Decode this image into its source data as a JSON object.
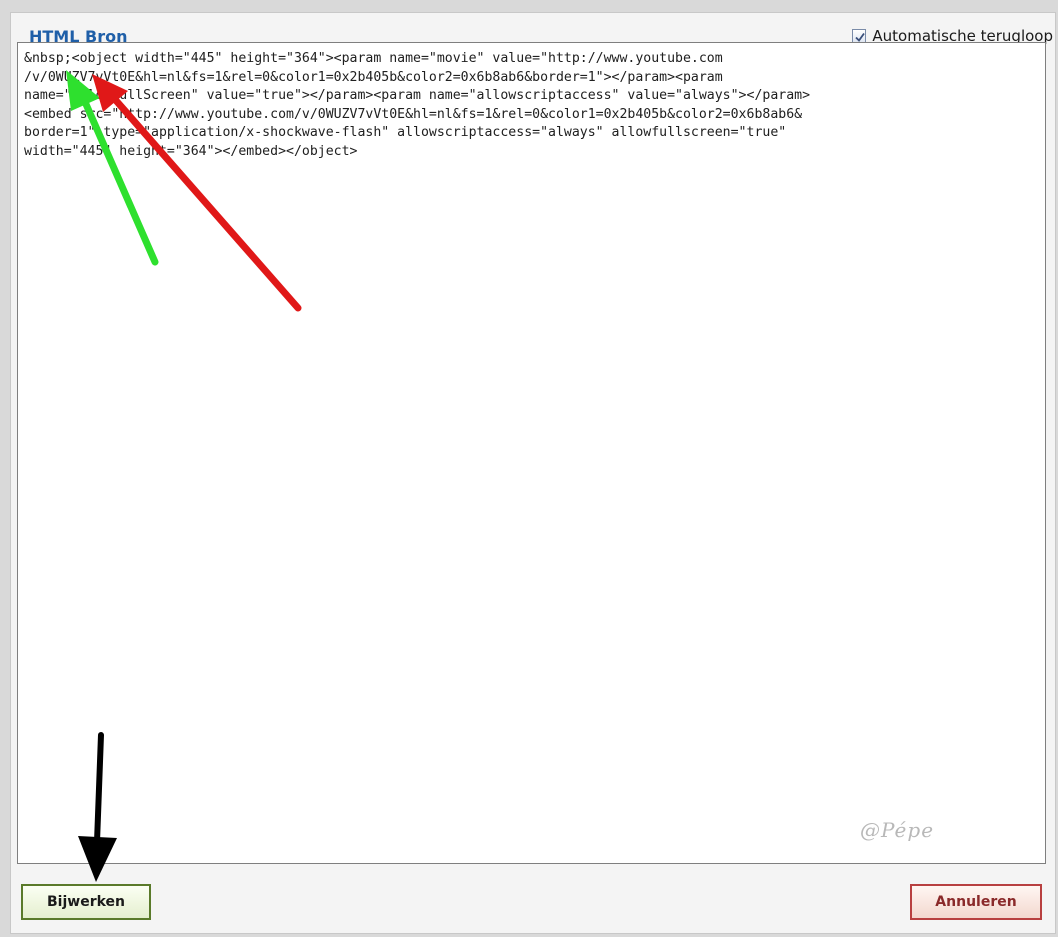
{
  "dialog": {
    "title": "HTML Bron",
    "wrap_option": {
      "label": "Automatische terugloop",
      "checked": true
    },
    "source_lines": [
      "&nbsp;<object width=\"445\" height=\"364\"><param name=\"movie\" value=\"http://www.youtube.com",
      "/v/0WUZV7vVt0E&hl=nl&fs=1&rel=0&color1=0x2b405b&color2=0x6b8ab6&border=1\"></param><param",
      "name=\"allowFullScreen\" value=\"true\"></param><param name=\"allowscriptaccess\" value=\"always\"></param>",
      "<embed src=\"http://www.youtube.com/v/0WUZV7vVt0E&hl=nl&fs=1&rel=0&color1=0x2b405b&color2=0x6b8ab6&",
      "border=1\" type=\"application/x-shockwave-flash\" allowscriptaccess=\"always\" allowfullscreen=\"true\"",
      "width=\"445\" height=\"364\"></embed></object>"
    ],
    "watermark": "@Pépe",
    "buttons": {
      "update_label": "Bijwerken",
      "cancel_label": "Annuleren"
    }
  },
  "annotations": {
    "green_arrow_color": "#2ee02e",
    "red_arrow_color": "#e01818",
    "black_arrow_color": "#000000"
  }
}
